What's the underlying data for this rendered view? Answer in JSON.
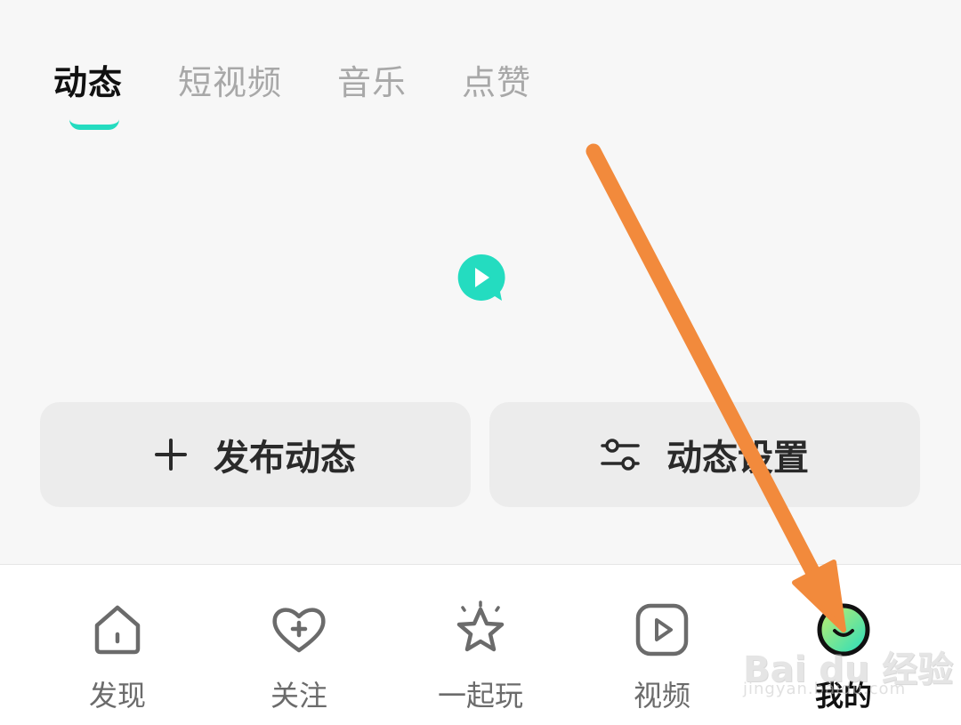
{
  "tabs": [
    {
      "label": "动态",
      "active": true
    },
    {
      "label": "短视频",
      "active": false
    },
    {
      "label": "音乐",
      "active": false
    },
    {
      "label": "点赞",
      "active": false
    }
  ],
  "actions": {
    "publish_label": "发布动态",
    "settings_label": "动态设置"
  },
  "bottom_nav": [
    {
      "label": "发现",
      "icon": "home-icon"
    },
    {
      "label": "关注",
      "icon": "heart-plus-icon"
    },
    {
      "label": "一起玩",
      "icon": "star-icon"
    },
    {
      "label": "视频",
      "icon": "video-play-icon"
    },
    {
      "label": "我的",
      "icon": "avatar-icon",
      "active": true
    }
  ],
  "watermark": {
    "main": "Bai du 经验",
    "sub": "jingyan.baidu.com"
  },
  "colors": {
    "accent": "#24dcc0",
    "annotation_arrow": "#f28a3c",
    "background": "#f7f7f7",
    "button_bg": "#ececec"
  }
}
